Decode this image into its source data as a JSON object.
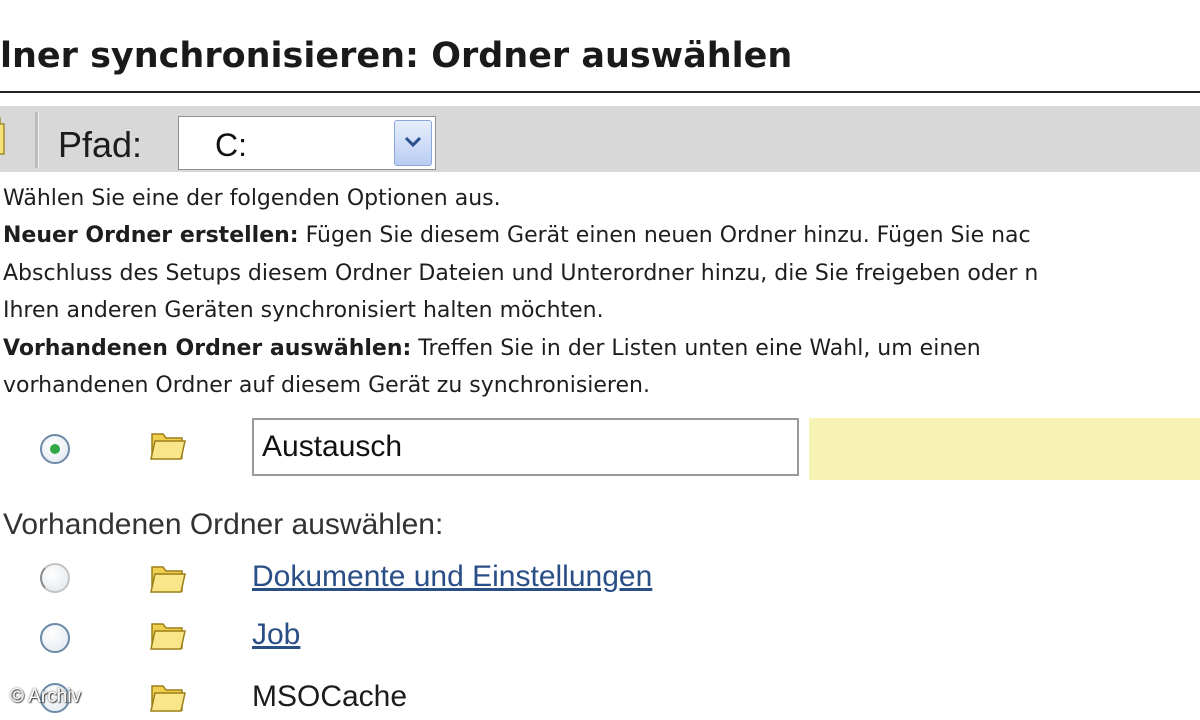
{
  "header": {
    "title": "lner synchronisieren: Ordner auswählen"
  },
  "toolbar": {
    "path_label": "Pfad:",
    "path_value": "C:",
    "folder_icon": "folder-icon",
    "dropdown_icon": "chevron-down-icon"
  },
  "description": {
    "intro": "Wählen Sie eine der folgenden Optionen aus.",
    "new_folder_label": "Neuer Ordner erstellen:",
    "new_folder_line1": " Fügen Sie diesem Gerät einen neuen Ordner hinzu. Fügen Sie nac",
    "new_folder_line2": "Abschluss des Setups diesem Ordner Dateien und Unterordner hinzu, die Sie freigeben oder n",
    "new_folder_line3": "Ihren anderen Geräten synchronisiert halten möchten.",
    "existing_label": "Vorhandenen Ordner auswählen:",
    "existing_line1": " Treffen Sie in der Listen unten eine Wahl, um einen",
    "existing_line2": "vorhandenen Ordner auf diesem Gerät zu synchronisieren."
  },
  "new_folder": {
    "value": "Austausch",
    "selected": true
  },
  "existing": {
    "label": "Vorhandenen Ordner auswählen:",
    "folders": [
      {
        "name": "Dokumente und Einstellungen",
        "link": true
      },
      {
        "name": "Job",
        "link": true
      },
      {
        "name": "MSOCache",
        "link": false
      }
    ]
  },
  "watermark": "© Archiv",
  "colors": {
    "toolbar_bg": "#d8d8d8",
    "highlight": "#f6f3b4",
    "link": "#2a4f86",
    "radio_dot": "#2fa845"
  }
}
